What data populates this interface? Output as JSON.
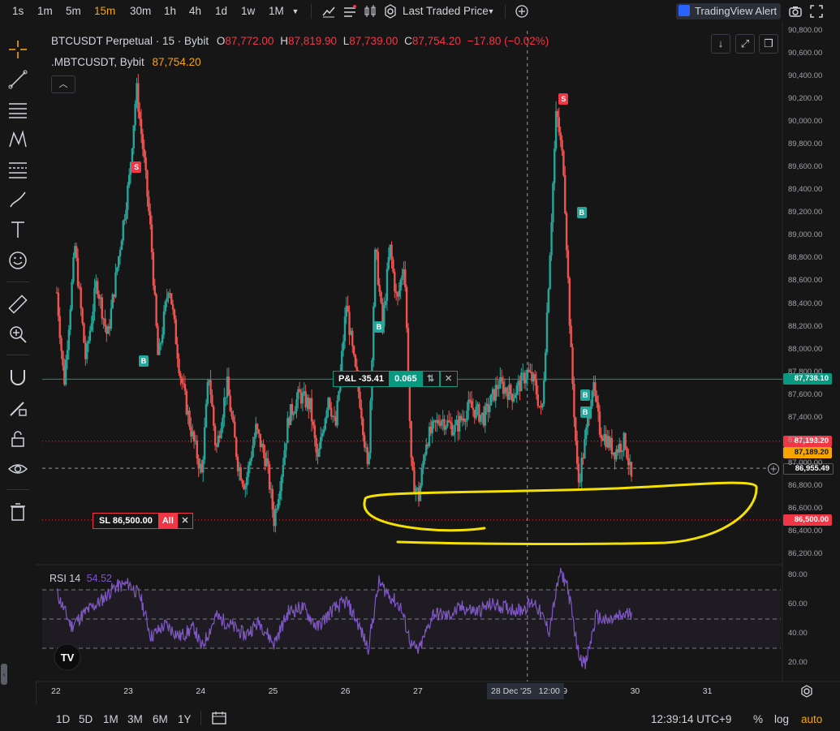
{
  "toolbar": {
    "timeframes": [
      "1s",
      "1m",
      "5m",
      "15m",
      "30m",
      "1h",
      "4h",
      "1d",
      "1w",
      "1M"
    ],
    "active_timeframe": "15m",
    "price_source": "Last Traded Price",
    "alert_label": "TradingView Alert"
  },
  "legend": {
    "symbol": "BTCUSDT Perpetual · 15 · Bybit",
    "o_label": "O",
    "o": "87,772.00",
    "h_label": "H",
    "h": "87,819.90",
    "l_label": "L",
    "l": "87,739.00",
    "c_label": "C",
    "c": "87,754.20",
    "change": "−17.80 (−0.02%)",
    "secondary_symbol": ".MBTCUSDT, Bybit",
    "secondary_value": "87,754.20"
  },
  "position": {
    "pnl_label": "P&L -35.41",
    "qty": "0.065",
    "sl_label": "SL 86,500.00",
    "sl_all": "All"
  },
  "price_labels": {
    "entry": "87,738.10",
    "last": "87,193.20",
    "mark": "87,189.20",
    "crosshair": "86,955.49",
    "sl": "86,500.00"
  },
  "rsi": {
    "label": "RSI 14",
    "value": "54.52"
  },
  "crosshair_date": "28 Dec '25   12:00",
  "bottom": {
    "ranges": [
      "1D",
      "5D",
      "1M",
      "3M",
      "6M",
      "1Y"
    ],
    "clock": "12:39:14 UTC+9",
    "percent": "%",
    "log": "log",
    "auto": "auto"
  },
  "colors": {
    "up": "#26a69a",
    "down": "#ef5350",
    "rsi": "#7e57c2",
    "highlight": "#f5e100"
  },
  "chart_data": [
    {
      "type": "candlestick",
      "title": "BTCUSDT Perpetual · 15 · Bybit",
      "x_ticks": [
        "22",
        "23",
        "24",
        "25",
        "26",
        "27",
        "28",
        "12:00",
        "29",
        "30",
        "31"
      ],
      "y_ticks": [
        86200,
        86400,
        86600,
        86800,
        87000,
        87200,
        87400,
        87600,
        87800,
        88000,
        88200,
        88400,
        88600,
        88800,
        89000,
        89200,
        89400,
        89600,
        89800,
        90000,
        90200,
        90400,
        90600,
        90800
      ],
      "ylim": [
        86200,
        90800
      ],
      "approx_close_path": [
        [
          22.0,
          88500
        ],
        [
          22.1,
          87700
        ],
        [
          22.25,
          88900
        ],
        [
          22.4,
          87900
        ],
        [
          22.55,
          88600
        ],
        [
          22.7,
          88100
        ],
        [
          22.85,
          88800
        ],
        [
          23.0,
          89500
        ],
        [
          23.1,
          90300
        ],
        [
          23.2,
          89700
        ],
        [
          23.3,
          89000
        ],
        [
          23.4,
          87900
        ],
        [
          23.55,
          88600
        ],
        [
          23.7,
          87800
        ],
        [
          23.85,
          87300
        ],
        [
          24.0,
          86900
        ],
        [
          24.1,
          87800
        ],
        [
          24.2,
          87100
        ],
        [
          24.35,
          87700
        ],
        [
          24.5,
          87000
        ],
        [
          24.6,
          86800
        ],
        [
          24.75,
          87300
        ],
        [
          24.9,
          87000
        ],
        [
          25.0,
          86500
        ],
        [
          25.1,
          86900
        ],
        [
          25.2,
          87400
        ],
        [
          25.35,
          87600
        ],
        [
          25.5,
          87500
        ],
        [
          25.6,
          87000
        ],
        [
          25.75,
          87600
        ],
        [
          25.85,
          87300
        ],
        [
          26.0,
          88400
        ],
        [
          26.1,
          87900
        ],
        [
          26.2,
          87500
        ],
        [
          26.3,
          86900
        ],
        [
          26.4,
          88900
        ],
        [
          26.5,
          88200
        ],
        [
          26.6,
          88900
        ],
        [
          26.7,
          88400
        ],
        [
          26.8,
          88800
        ],
        [
          26.9,
          86900
        ],
        [
          27.0,
          86700
        ],
        [
          27.1,
          87200
        ],
        [
          27.3,
          87400
        ],
        [
          27.5,
          87300
        ],
        [
          27.7,
          87500
        ],
        [
          27.9,
          87400
        ],
        [
          28.1,
          87700
        ],
        [
          28.3,
          87600
        ],
        [
          28.5,
          87800
        ],
        [
          28.6,
          87700
        ],
        [
          28.7,
          87400
        ],
        [
          28.8,
          88700
        ],
        [
          28.9,
          90100
        ],
        [
          29.0,
          89600
        ],
        [
          29.1,
          88000
        ],
        [
          29.2,
          86800
        ],
        [
          29.3,
          87200
        ],
        [
          29.4,
          87700
        ],
        [
          29.5,
          87300
        ],
        [
          29.6,
          87200
        ],
        [
          29.7,
          87100
        ],
        [
          29.85,
          87200
        ],
        [
          29.95,
          86800
        ]
      ],
      "horizontal_lines": [
        {
          "label": "entry",
          "value": 87738.1
        },
        {
          "label": "last",
          "value": 87193.2
        },
        {
          "label": "crosshair",
          "value": 86955.49
        },
        {
          "label": "SL",
          "value": 86500.0
        }
      ],
      "markers": [
        {
          "x": 23.1,
          "y": 89600,
          "type": "S"
        },
        {
          "x": 23.2,
          "y": 87900,
          "type": "B"
        },
        {
          "x": 26.45,
          "y": 88200,
          "type": "B"
        },
        {
          "x": 29.0,
          "y": 90200,
          "type": "S"
        },
        {
          "x": 29.25,
          "y": 89200,
          "type": "B"
        },
        {
          "x": 29.3,
          "y": 87600,
          "type": "B"
        },
        {
          "x": 29.3,
          "y": 87450,
          "type": "B"
        }
      ]
    },
    {
      "type": "line",
      "title": "RSI 14",
      "y_ticks": [
        20,
        40,
        60,
        80
      ],
      "ylim": [
        15,
        85
      ],
      "bands": [
        30,
        50,
        70
      ],
      "approx_values": [
        [
          22.0,
          68
        ],
        [
          22.2,
          45
        ],
        [
          22.4,
          55
        ],
        [
          22.6,
          62
        ],
        [
          22.8,
          72
        ],
        [
          23.0,
          74
        ],
        [
          23.15,
          66
        ],
        [
          23.3,
          38
        ],
        [
          23.5,
          46
        ],
        [
          23.7,
          38
        ],
        [
          23.9,
          44
        ],
        [
          24.0,
          30
        ],
        [
          24.2,
          52
        ],
        [
          24.4,
          46
        ],
        [
          24.6,
          39
        ],
        [
          24.8,
          48
        ],
        [
          25.0,
          33
        ],
        [
          25.2,
          55
        ],
        [
          25.4,
          58
        ],
        [
          25.6,
          44
        ],
        [
          25.8,
          56
        ],
        [
          26.0,
          62
        ],
        [
          26.15,
          48
        ],
        [
          26.3,
          30
        ],
        [
          26.45,
          75
        ],
        [
          26.6,
          66
        ],
        [
          26.75,
          58
        ],
        [
          26.9,
          32
        ],
        [
          27.0,
          28
        ],
        [
          27.2,
          54
        ],
        [
          27.4,
          52
        ],
        [
          27.6,
          58
        ],
        [
          27.8,
          55
        ],
        [
          28.0,
          60
        ],
        [
          28.2,
          58
        ],
        [
          28.4,
          56
        ],
        [
          28.6,
          62
        ],
        [
          28.8,
          42
        ],
        [
          28.95,
          82
        ],
        [
          29.05,
          74
        ],
        [
          29.2,
          28
        ],
        [
          29.3,
          18
        ],
        [
          29.45,
          52
        ],
        [
          29.6,
          48
        ],
        [
          29.8,
          52
        ],
        [
          29.95,
          54.52
        ]
      ]
    }
  ]
}
